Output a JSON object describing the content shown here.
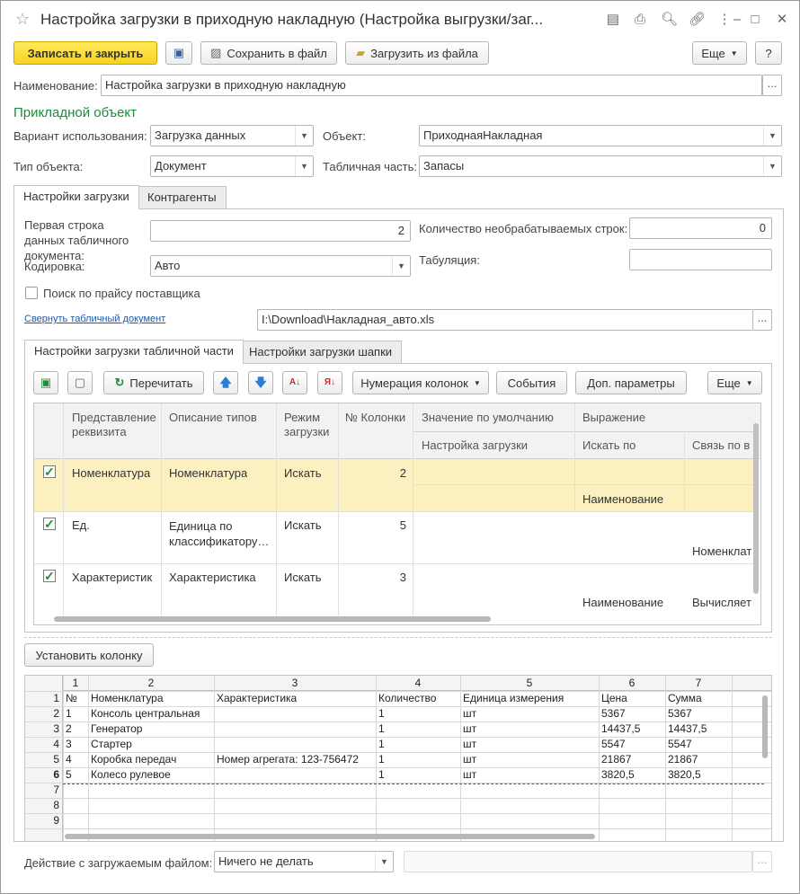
{
  "window": {
    "title": "Настройка загрузки в приходную накладную (Настройка выгрузки/заг..."
  },
  "toolbar": {
    "save_close": "Записать и закрыть",
    "save_file": "Сохранить в файл",
    "load_file": "Загрузить из файла",
    "more": "Еще",
    "help": "?"
  },
  "form": {
    "name_label": "Наименование:",
    "name_value": "Настройка загрузки в приходную накладную",
    "section_title": "Прикладной объект",
    "usage_label": "Вариант использования:",
    "usage_value": "Загрузка данных",
    "object_label": "Объект:",
    "object_value": "ПриходнаяНакладная",
    "objtype_label": "Тип объекта:",
    "objtype_value": "Документ",
    "tabpart_label": "Табличная часть:",
    "tabpart_value": "Запасы"
  },
  "tabs": {
    "settings": "Настройки загрузки",
    "contractors": "Контрагенты"
  },
  "settings": {
    "first_row_label": "Первая строка данных табличного документа:",
    "first_row_value": "2",
    "skip_rows_label": "Количество необрабатываемых строк:",
    "skip_rows_value": "0",
    "encoding_label": "Кодировка:",
    "encoding_value": "Авто",
    "tab_label": "Табуляция:",
    "tab_value": "",
    "price_search_label": "Поиск по прайсу поставщика",
    "collapse_link": "Свернуть табличный документ",
    "file_path": "I:\\Download\\Накладная_авто.xls"
  },
  "subtabs": {
    "table": "Настройки загрузки табличной части",
    "header": "Настройки загрузки шапки"
  },
  "gridtoolbar": {
    "reread": "Перечитать",
    "numbering": "Нумерация колонок",
    "events": "События",
    "extra": "Доп. параметры",
    "more": "Еще"
  },
  "grid": {
    "headers": {
      "repr": "Представление реквизита",
      "types": "Описание типов",
      "mode": "Режим загрузки",
      "colnum": "№ Колонки",
      "default": "Значение по умолчанию",
      "expr": "Выражение",
      "loadset": "Настройка загрузки",
      "searchby": "Искать по",
      "link": "Связь по в"
    },
    "rows": [
      {
        "repr": "Номенклатура",
        "types": "Номенклатура",
        "mode": "Искать",
        "colnum": "2",
        "searchby": "Наименование",
        "link": ""
      },
      {
        "repr": "Ед.",
        "types": "Единица по классификатору…",
        "mode": "Искать",
        "colnum": "5",
        "searchby": "",
        "link": "Номенклат"
      },
      {
        "repr": "Характеристик",
        "types": "Характеристика",
        "mode": "Искать",
        "colnum": "3",
        "searchby": "Наименование",
        "link": "Вычисляет"
      }
    ]
  },
  "set_column": "Установить колонку",
  "sheet": {
    "col_headers": [
      "1",
      "2",
      "3",
      "4",
      "5",
      "6",
      "7"
    ],
    "row_headers": [
      "1",
      "2",
      "3",
      "4",
      "5",
      "6",
      "7",
      "8",
      "9"
    ],
    "rows": [
      [
        "№",
        "Номенклатура",
        "Характеристика",
        "Количество",
        "Единица измерения",
        "Цена",
        "Сумма"
      ],
      [
        "1",
        "Консоль центральная",
        "",
        "1",
        "шт",
        "5367",
        "5367"
      ],
      [
        "2",
        "Генератор",
        "",
        "1",
        "шт",
        "14437,5",
        "14437,5"
      ],
      [
        "3",
        "Стартер",
        "",
        "1",
        "шт",
        "5547",
        "5547"
      ],
      [
        "4",
        "Коробка передач",
        "Номер агрегата: 123-756472",
        "1",
        "шт",
        "21867",
        "21867"
      ],
      [
        "5",
        "Колесо рулевое",
        "",
        "1",
        "шт",
        "3820,5",
        "3820,5"
      ]
    ]
  },
  "footer": {
    "action_label": "Действие с загружаемым файлом:",
    "action_value": "Ничего не делать"
  },
  "colors": {
    "accent_green": "#1c8a3c",
    "selected_row": "#fbf0c0",
    "primary_button": "#f5d422"
  }
}
